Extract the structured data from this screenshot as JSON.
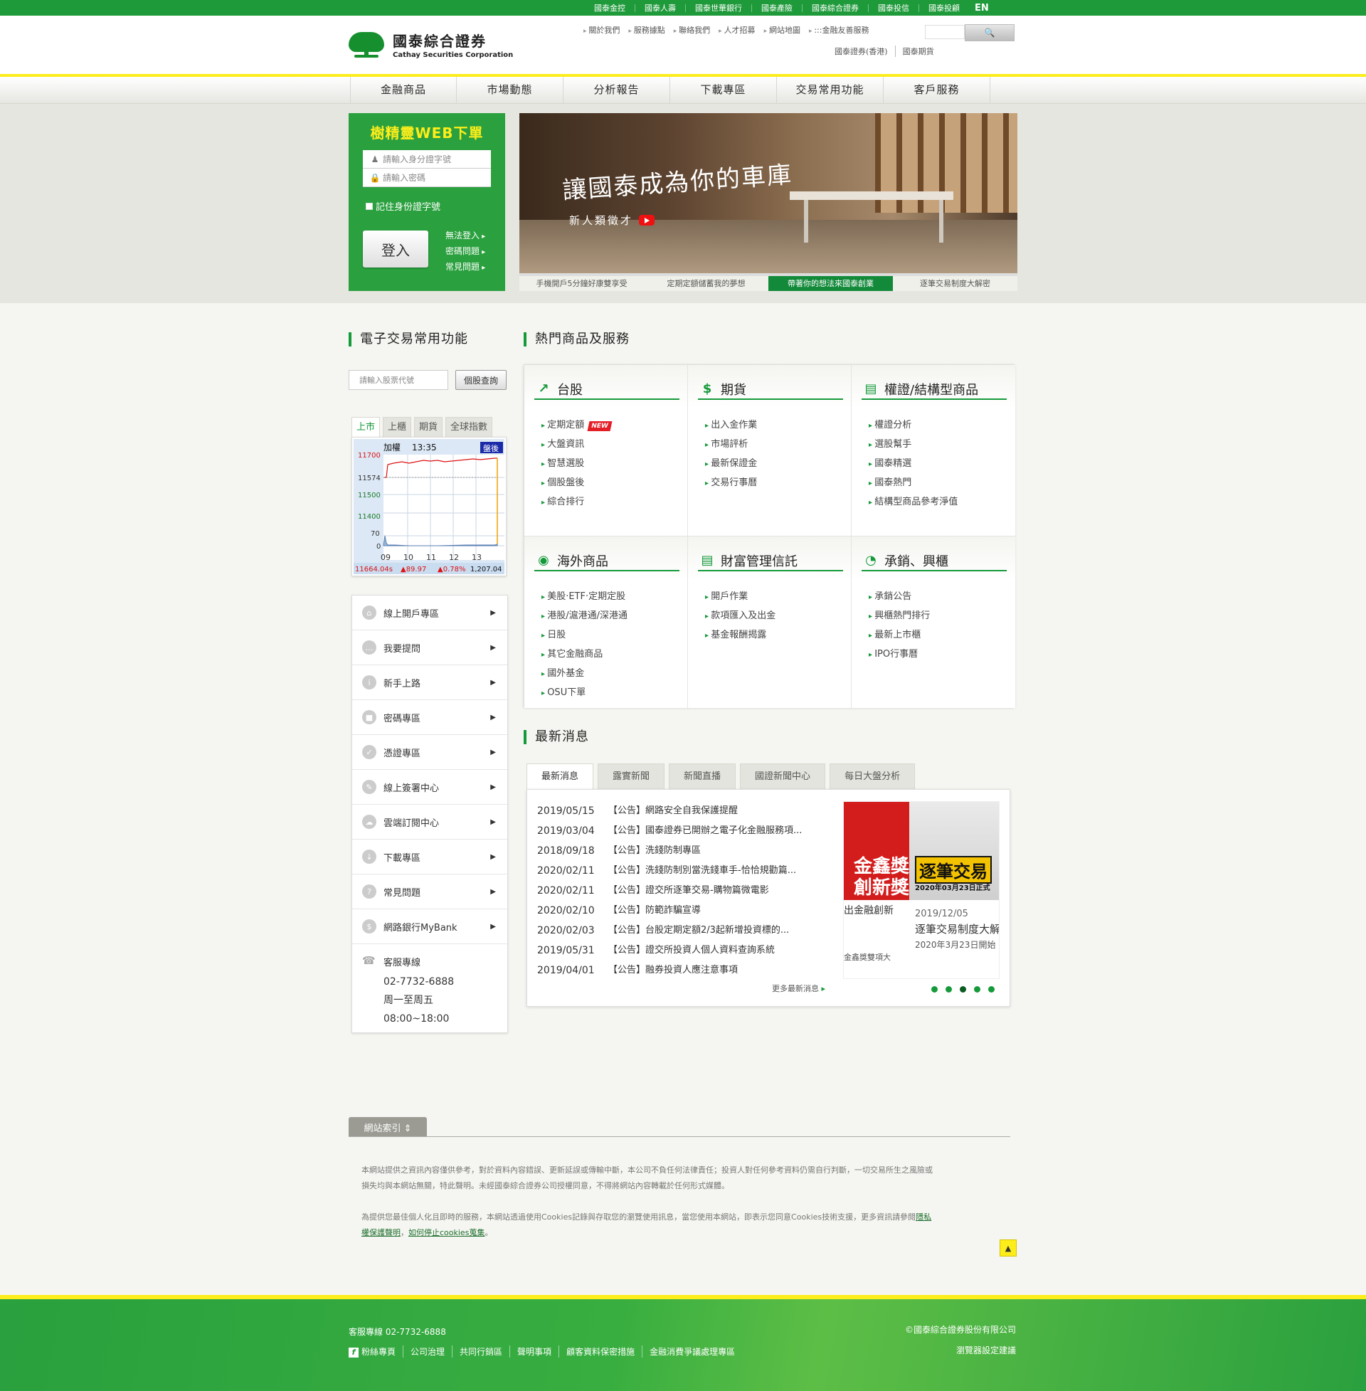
{
  "topbar": {
    "links": [
      "國泰金控",
      "國泰人壽",
      "國泰世華銀行",
      "國泰產險",
      "國泰綜合證券",
      "國泰投信",
      "國泰投顧"
    ],
    "lang": "EN"
  },
  "header": {
    "logo_cn": "國泰綜合證券",
    "logo_en": "Cathay Securities Corporation",
    "links": [
      "關於我們",
      "服務據點",
      "聯絡我們",
      "人才招募",
      "網站地圖",
      ":::金融友善服務"
    ],
    "links2": [
      "國泰證券(香港)",
      "國泰期貨"
    ],
    "search_icon": "search-icon"
  },
  "nav": [
    "金融商品",
    "市場動態",
    "分析報告",
    "下載專區",
    "交易常用功能",
    "客戶服務"
  ],
  "login": {
    "title": "樹精靈WEB下單",
    "id_placeholder": "請輸入身分證字號",
    "pw_placeholder": "請輸入密碼",
    "remember": "記住身份證字號",
    "button": "登入",
    "help": [
      "無法登入",
      "密碼問題",
      "常見問題"
    ]
  },
  "banner": {
    "slogan": "讓國泰成為你的車庫",
    "sub": "新人類徵才",
    "tabs": [
      "手機開戶5分鐘好康雙享受",
      "定期定額儲蓄我的夢想",
      "帶著你的想法來國泰創業",
      "逐筆交易制度大解密"
    ],
    "active_tab": 2
  },
  "etrade": {
    "title": "電子交易常用功能",
    "stock_placeholder": "請輸入股票代號",
    "stock_button": "個股查詢",
    "index_tabs": [
      "上市",
      "上櫃",
      "期貨",
      "全球指數"
    ],
    "chart": {
      "label": "加權",
      "time": "13:35",
      "badge": "盤後",
      "y_labels": [
        "11700",
        "11574",
        "11500",
        "11400",
        "70",
        "0"
      ],
      "x_labels": [
        "09",
        "10",
        "11",
        "12",
        "13"
      ],
      "footer_index": "11664.04s",
      "footer_change": "▲89.97",
      "footer_pct": "▲0.78%",
      "footer_vol": "1,207.04"
    }
  },
  "quick_links": [
    {
      "label": "線上開戶專區",
      "icon": "bank-icon"
    },
    {
      "label": "我要提問",
      "icon": "chat-icon"
    },
    {
      "label": "新手上路",
      "icon": "info-icon"
    },
    {
      "label": "密碼專區",
      "icon": "lock-icon"
    },
    {
      "label": "憑證專區",
      "icon": "check-icon"
    },
    {
      "label": "線上簽署中心",
      "icon": "sign-icon"
    },
    {
      "label": "雲端訂閱中心",
      "icon": "cloud-icon"
    },
    {
      "label": "下載專區",
      "icon": "download-icon"
    },
    {
      "label": "常見問題",
      "icon": "question-icon"
    },
    {
      "label": "網路銀行MyBank",
      "icon": "piggybank-icon"
    }
  ],
  "service": {
    "title": "客服專線",
    "phone": "02-7732-6888",
    "days": "周一至周五",
    "hours": "08:00~18:00"
  },
  "hot": {
    "title": "熱門商品及服務",
    "cells": [
      {
        "title": "台股",
        "icon": "chart-up-icon",
        "items": [
          "定期定額",
          "大盤資訊",
          "智慧選股",
          "個股盤後",
          "綜合排行"
        ],
        "new_index": 0
      },
      {
        "title": "期貨",
        "icon": "money-icon",
        "items": [
          "出入金作業",
          "市場評析",
          "最新保證金",
          "交易行事曆"
        ]
      },
      {
        "title": "權證/結構型商品",
        "icon": "document-icon",
        "items": [
          "權證分析",
          "選股幫手",
          "國泰精選",
          "國泰熱門",
          "結構型商品參考淨值"
        ]
      },
      {
        "title": "海外商品",
        "icon": "globe-icon",
        "items": [
          "美股·ETF·定期定股",
          "港股/滬港通/深港通",
          "日股",
          "其它金融商品",
          "國外基金",
          "OSU下單"
        ]
      },
      {
        "title": "財富管理信託",
        "icon": "coins-icon",
        "items": [
          "開戶作業",
          "款項匯入及出金",
          "基金報酬揭露"
        ]
      },
      {
        "title": "承銷、興櫃",
        "icon": "pie-icon",
        "items": [
          "承銷公告",
          "興櫃熱門排行",
          "最新上市櫃",
          "IPO行事曆"
        ]
      }
    ],
    "new_label": "NEW"
  },
  "news": {
    "title": "最新消息",
    "tabs": [
      "最新消息",
      "露實新聞",
      "新聞直播",
      "國證新聞中心",
      "每日大盤分析"
    ],
    "items": [
      {
        "date": "2019/05/15",
        "text": "【公告】網路安全自我保護提醒"
      },
      {
        "date": "2019/03/04",
        "text": "【公告】國泰證券已開辦之電子化金融服務項..."
      },
      {
        "date": "2018/09/18",
        "text": "【公告】洗錢防制專區"
      },
      {
        "date": "2020/02/11",
        "text": "【公告】洗錢防制別當洗錢車手-恰恰規勸篇..."
      },
      {
        "date": "2020/02/11",
        "text": "【公告】證交所逐筆交易-購物篇微電影"
      },
      {
        "date": "2020/02/10",
        "text": "【公告】防範詐騙宣導"
      },
      {
        "date": "2020/02/03",
        "text": "【公告】台股定期定額2/3起新增投資標的..."
      },
      {
        "date": "2019/05/31",
        "text": "【公告】證交所投資人個人資料查詢系統"
      },
      {
        "date": "2019/04/01",
        "text": "【公告】融券投資人應注意事項"
      }
    ],
    "more": "更多最新消息",
    "slide1_line1": "金鑫獎",
    "slide1_line2": "創新獎",
    "slide1_caption": "出金融創新",
    "slide1_caption2": "金鑫獎雙項大",
    "slide2_tag": "逐筆交易",
    "slide2_sub": "2020年03月23日正式",
    "slide2_date": "2019/12/05",
    "slide2_caption": "逐筆交易制度大解",
    "slide2_caption2": "2020年3月23日開始"
  },
  "sitemap": {
    "tab": "網站索引 ⇕",
    "disclaimer1": "本網站提供之資訊內容僅供參考，對於資料內容錯誤、更新延誤或傳輸中斷，本公司不負任何法律責任；投資人對任何參考資料仍需自行判斷，一切交易所生之風險或損失均與本網站無關，特此聲明。未經國泰綜合證券公司授權同意，不得將網站內容轉載於任何形式媒體。",
    "disclaimer2": "為提供您最佳個人化且即時的服務，本網站透過使用Cookies記錄與存取您的瀏覽使用訊息，當您使用本網站，即表示您同意Cookies技術支援，更多資訊請參閱",
    "privacy_link": "隱私權保護聲明",
    "cookie_link": "如何停止cookies蒐集",
    "to_top": "▲"
  },
  "footer": {
    "tel": "客服專線 02-7732-6888",
    "links": [
      "粉絲專頁",
      "公司治理",
      "共同行銷區",
      "聲明事項",
      "顧客資料保密措施",
      "金融消費爭議處理專區"
    ],
    "copyright": "©國泰綜合證券股份有限公司",
    "browser": "瀏覽器設定建議"
  },
  "colors": {
    "brand_green": "#1e9a3a",
    "accent_yellow": "#fced1b",
    "up_red": "#e41e26"
  }
}
